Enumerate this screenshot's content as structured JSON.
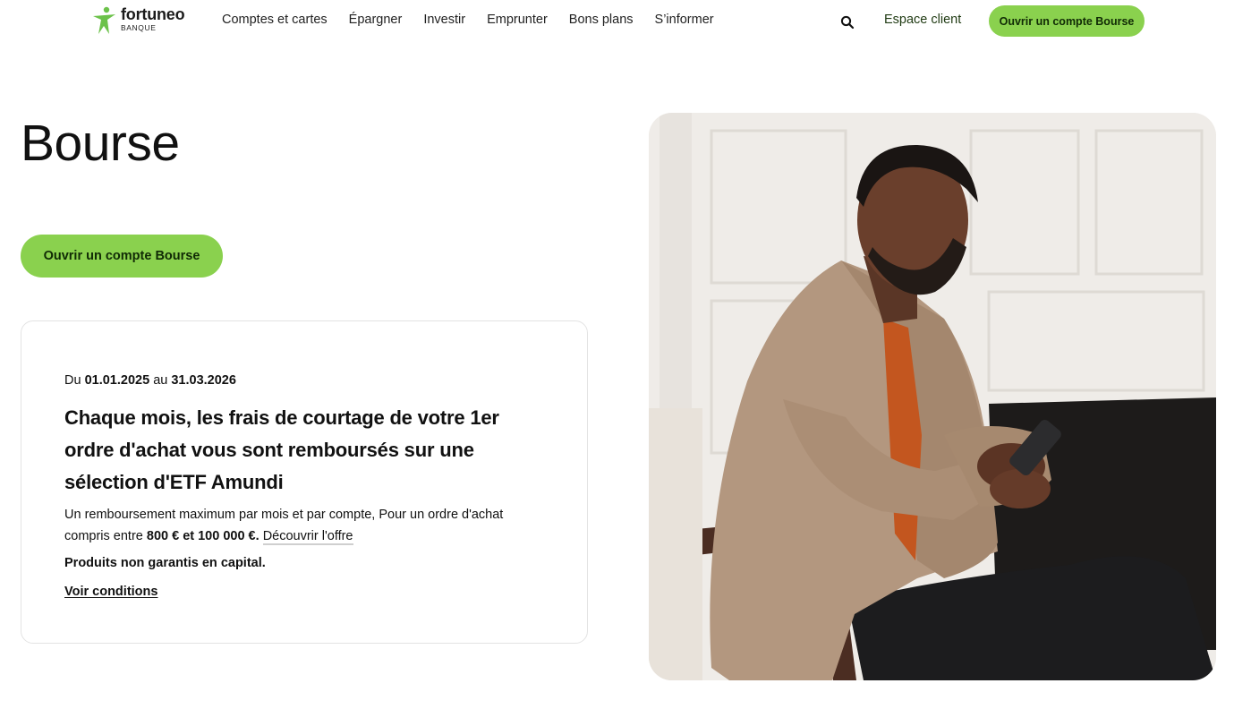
{
  "header": {
    "logo": {
      "name": "fortuneo",
      "sub": "BANQUE"
    },
    "nav": [
      {
        "label": "Comptes et cartes"
      },
      {
        "label": "Épargner"
      },
      {
        "label": "Investir"
      },
      {
        "label": "Emprunter"
      },
      {
        "label": "Bons plans"
      },
      {
        "label": "S’informer"
      }
    ],
    "search_icon": "search-icon",
    "espace_client": "Espace client",
    "cta": "Ouvrir un compte Bourse"
  },
  "hero": {
    "title": "Bourse",
    "cta": "Ouvrir un compte Bourse"
  },
  "offer": {
    "period_prefix": "Du",
    "period_start": "01.01.2025",
    "period_mid": "au",
    "period_end": "31.03.2026",
    "headline": "Chaque mois, les frais de courtage de votre 1er ordre d'achat vous sont remboursés sur une sélection d'ETF Amundi",
    "desc_text": "Un remboursement maximum par mois et par compte, Pour un ordre d'achat compris entre",
    "desc_amount": "800 € et 100 000 €.",
    "desc_link": "Découvrir l'offre",
    "warning": "Produits non garantis en capital.",
    "conditions": "Voir conditions"
  },
  "colors": {
    "brand_green": "#8ad14e",
    "logo_green": "#6cc24a",
    "text_dark": "#111111"
  }
}
